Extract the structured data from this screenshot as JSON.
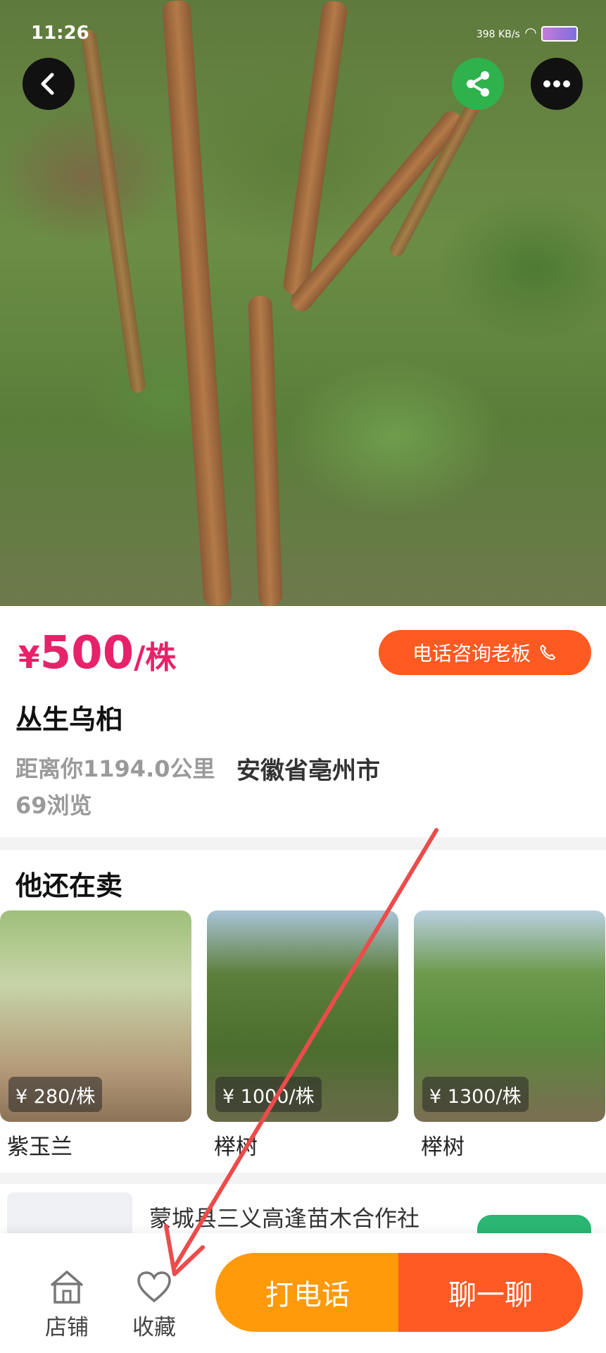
{
  "status_bar": {
    "time": "11:26",
    "network_speed": "398 KB/s"
  },
  "product": {
    "price_currency": "¥",
    "price_value": "500",
    "price_unit": "/株",
    "consult_label": "电话咨询老板",
    "title": "丛生乌桕",
    "distance": "距离你1194.0公里",
    "location": "安徽省亳州市",
    "views": "69浏览"
  },
  "other_items": {
    "title": "他还在卖",
    "cards": [
      {
        "price": "¥ 280/株",
        "name": "紫玉兰"
      },
      {
        "price": "¥ 1000/株",
        "name": "榉树"
      },
      {
        "price": "¥ 1300/株",
        "name": "榉树"
      }
    ]
  },
  "seller": {
    "name": "蒙城县三义高逢苗木合作社"
  },
  "bottom_bar": {
    "shop_label": "店铺",
    "favorite_label": "收藏",
    "call_label": "打电话",
    "chat_label": "聊一聊"
  },
  "colors": {
    "price": "#e8226a",
    "consult": "#ff5a22",
    "call": "#ff9a0a",
    "chat": "#ff5a24",
    "share": "#2fb24c"
  },
  "icons": [
    "back-arrow-icon",
    "share-icon",
    "more-icon",
    "phone-icon",
    "shop-icon",
    "heart-icon"
  ]
}
